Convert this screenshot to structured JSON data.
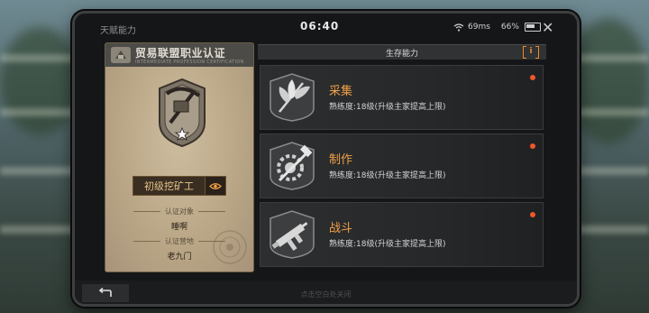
{
  "status": {
    "app_name": "天赋能力",
    "time": "06:40",
    "ping": "69ms",
    "battery": "66%"
  },
  "certificate": {
    "title": "贸易联盟职业认证",
    "subtitle": "INTERMEDIATE PROFESSION CERTIFICATION",
    "rank": "初级挖矿工",
    "target_label": "认证对象",
    "target_value": "睡啊",
    "camp_label": "认证营地",
    "camp_value": "老九门"
  },
  "panel": {
    "title": "生存能力",
    "info_label": "i"
  },
  "skills": [
    {
      "name": "采集",
      "level": "熟练度:18级(升级主家提高上限)",
      "icon": "herb-leaf-icon"
    },
    {
      "name": "制作",
      "level": "熟练度:18级(升级主家提高上限)",
      "icon": "gear-hammer-icon"
    },
    {
      "name": "战斗",
      "level": "熟练度:18级(升级主家提高上限)",
      "icon": "smg-gun-icon"
    }
  ],
  "footer": {
    "hint": "点击空白处关闭"
  },
  "colors": {
    "accent": "#f0a048",
    "notify_dot": "#f0562c",
    "info_orange": "#f08a2c"
  }
}
